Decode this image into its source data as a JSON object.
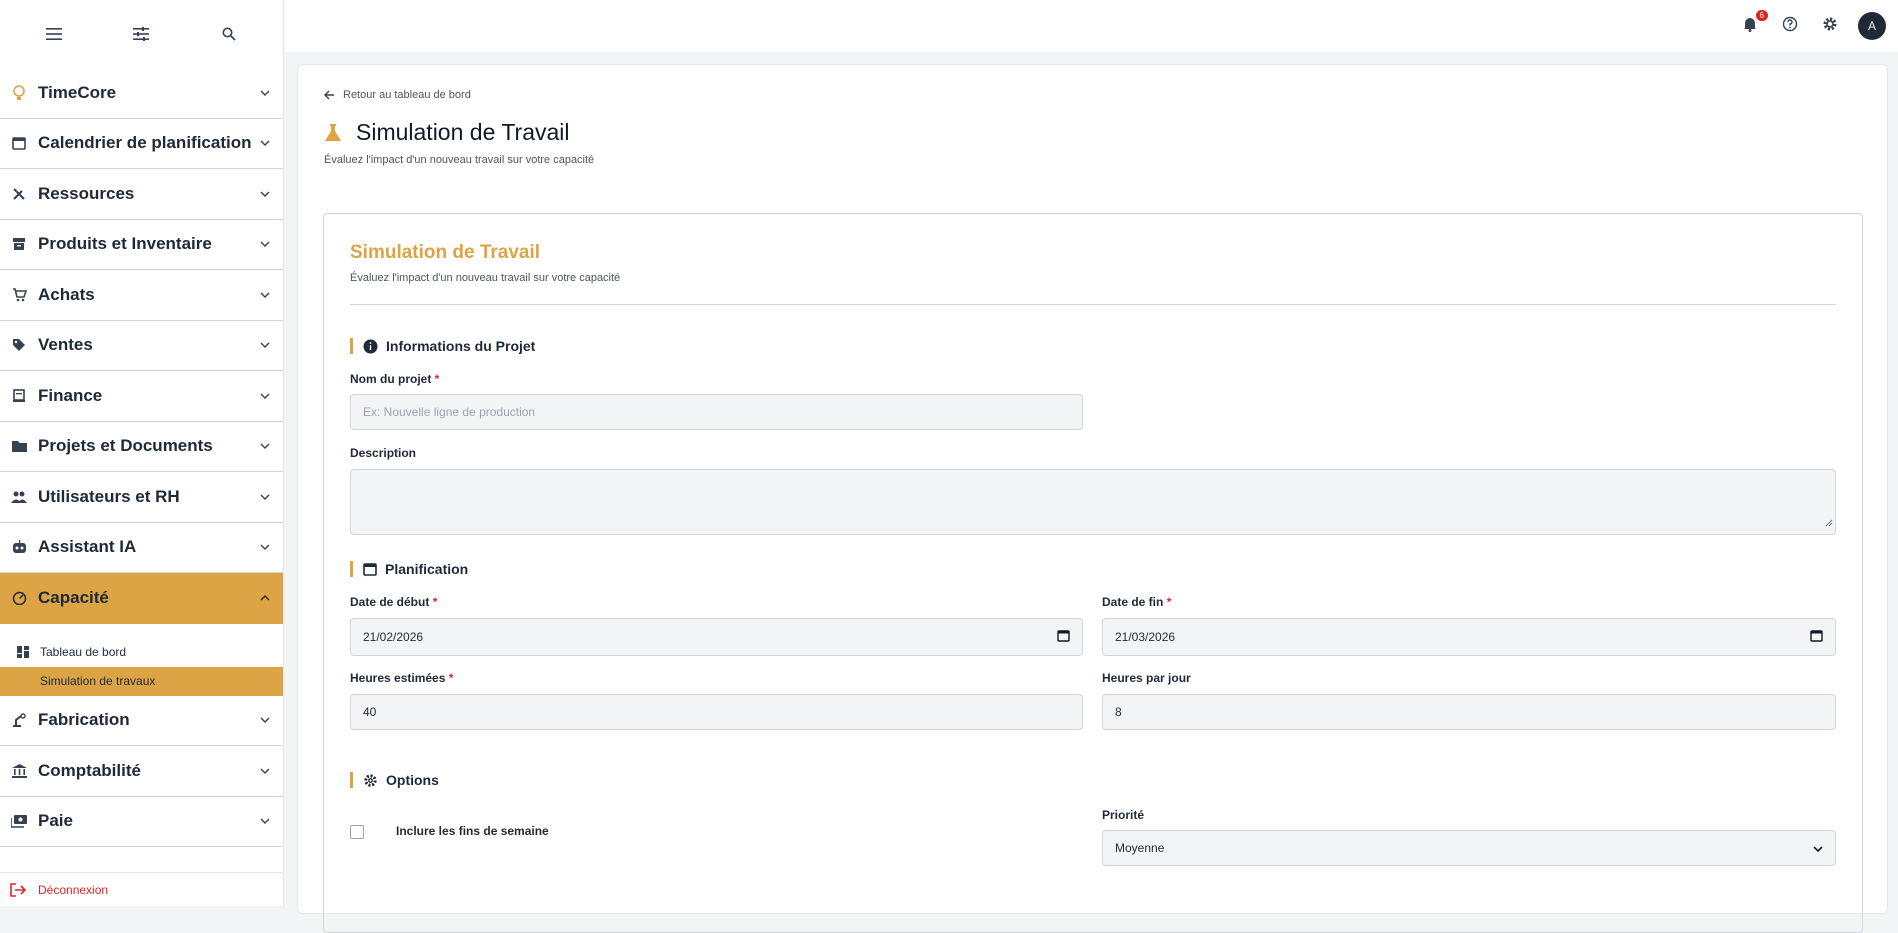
{
  "sidebar": {
    "items": [
      {
        "label": "TimeCore",
        "icon": "bulb-icon"
      },
      {
        "label": "Calendrier de planification",
        "icon": "calendar-icon"
      },
      {
        "label": "Ressources",
        "icon": "tools-icon"
      },
      {
        "label": "Produits et Inventaire",
        "icon": "archive-icon"
      },
      {
        "label": "Achats",
        "icon": "cart-icon"
      },
      {
        "label": "Ventes",
        "icon": "tag-icon"
      },
      {
        "label": "Finance",
        "icon": "ledger-icon"
      },
      {
        "label": "Projets et Documents",
        "icon": "folder-icon"
      },
      {
        "label": "Utilisateurs et RH",
        "icon": "people-icon"
      },
      {
        "label": "Assistant IA",
        "icon": "robot-icon"
      },
      {
        "label": "Capacité",
        "icon": "gauge-icon"
      },
      {
        "label": "Fabrication",
        "icon": "robot-arm-icon"
      },
      {
        "label": "Comptabilité",
        "icon": "bank-icon"
      },
      {
        "label": "Paie",
        "icon": "payments-icon"
      }
    ],
    "sub_items": [
      {
        "label": "Tableau de bord"
      },
      {
        "label": "Simulation de travaux"
      }
    ],
    "logout": "Déconnexion"
  },
  "topbar": {
    "notification_count": "6",
    "avatar_initial": "A"
  },
  "page": {
    "back_label": "Retour au tableau de bord",
    "title": "Simulation de Travail",
    "subtitle": "Évaluez l'impact d'un nouveau travail sur votre capacité"
  },
  "card": {
    "title": "Simulation de Travail",
    "subtitle": "Évaluez l'impact d'un nouveau travail sur votre capacité",
    "section_project": "Informations du Projet",
    "project_name_label": "Nom du projet",
    "project_name_placeholder": "Ex: Nouvelle ligne de production",
    "description_label": "Description",
    "section_planning": "Planification",
    "start_date_label": "Date de début",
    "start_date_value": "21/02/2026",
    "end_date_label": "Date de fin",
    "end_date_value": "21/03/2026",
    "estimated_hours_label": "Heures estimées",
    "estimated_hours_value": "40",
    "hours_per_day_label": "Heures par jour",
    "hours_per_day_value": "8",
    "section_options": "Options",
    "weekends_label": "Inclure les fins de semaine",
    "priority_label": "Priorité",
    "priority_value": "Moyenne",
    "required_mark": "*"
  },
  "colors": {
    "accent": "#dda446",
    "danger": "#dc2626"
  }
}
